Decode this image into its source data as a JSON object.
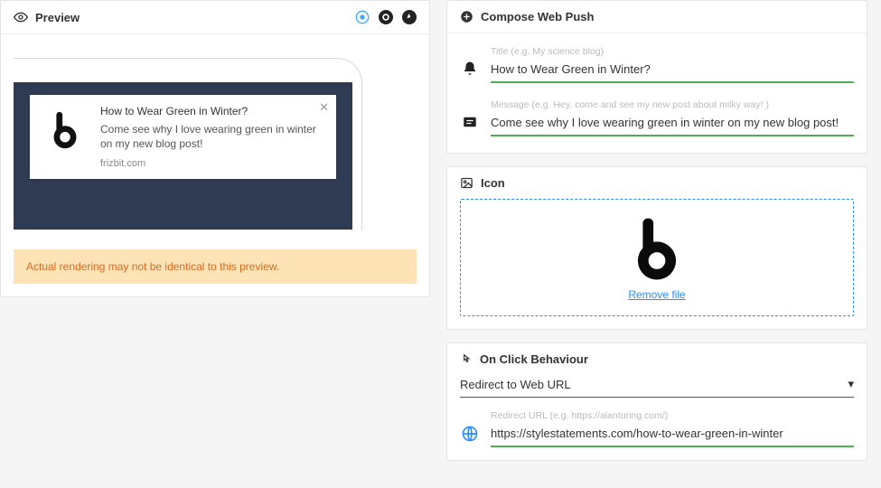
{
  "preview": {
    "header_label": "Preview",
    "notification": {
      "title": "How to Wear Green in Winter?",
      "message": "Come see why I love wearing green in winter on my new blog post!",
      "domain": "frizbit.com"
    },
    "warning": "Actual rendering may not be identical to this preview."
  },
  "compose": {
    "header_label": "Compose Web Push",
    "title_hint": "Title (e.g. My science blog)",
    "title_value": "How to Wear Green in Winter?",
    "message_hint": "Message (e.g. Hey, come and see my new post about milky way! )",
    "message_value": "Come see why I love wearing green in winter on my new blog post!"
  },
  "icon": {
    "header_label": "Icon",
    "remove_label": "Remove file"
  },
  "onclick": {
    "header_label": "On Click Behaviour",
    "select_value": "Redirect to Web URL",
    "url_hint": "Redirect URL (e.g. https://alanturing.com/)",
    "url_value": "https://stylestatements.com/how-to-wear-green-in-winter"
  }
}
